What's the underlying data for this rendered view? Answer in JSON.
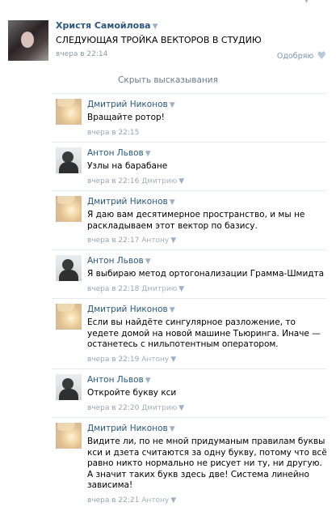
{
  "post": {
    "author": "Христя Самойлова",
    "text": "СЛЕДУЮЩАЯ ТРОЙКА ВЕКТОРОВ В СТУДИЮ",
    "date": "вчера в 22:14",
    "like_label": "Одобряю"
  },
  "icons": {
    "dropdown": "▼",
    "heart": "♥"
  },
  "hide_label": "Скрыть высказывания",
  "comments": [
    {
      "author": "Дмитрий Никонов",
      "avatar": "blond-avatar",
      "text": "Вращайте ротор!",
      "time": "вчера в 22:15",
      "reply_to": ""
    },
    {
      "author": "Антон Львов",
      "avatar": "dark-avatar",
      "text": "Узлы на барабане",
      "time": "вчера в 22:16",
      "reply_to": "Дмитрию"
    },
    {
      "author": "Дмитрий Никонов",
      "avatar": "blond-avatar",
      "text": "Я даю вам десятимерное пространство, и мы не раскладываем этот вектор по базису.",
      "time": "вчера в 22:17",
      "reply_to": "Антону"
    },
    {
      "author": "Антон Львов",
      "avatar": "dark-avatar",
      "text": "Я выбираю метод ортогонализации Грамма-Шмидта",
      "time": "вчера в 22:18",
      "reply_to": "Дмитрию"
    },
    {
      "author": "Дмитрий Никонов",
      "avatar": "blond-avatar",
      "text": "Если вы найдёте сингулярное разложение, то уедете домой на новой машине Тьюринга. Иначе — останетесь с нильпотентным оператором.",
      "time": "вчера в 22:19",
      "reply_to": "Антону"
    },
    {
      "author": "Антон Львов",
      "avatar": "dark-avatar",
      "text": "Откройте букву кси",
      "time": "вчера в 22:20",
      "reply_to": "Дмитрию"
    },
    {
      "author": "Дмитрий Никонов",
      "avatar": "blond-avatar",
      "text": "Видите ли, по не мной придуманым правилам буквы кси и дзета считаются за одну букву, потому что всё равно никто нормально не рисует ни ту, ни другую.\nА значит таких букв здесь две! Система линейно зависима!",
      "time": "вчера в 22:21",
      "reply_to": "Антону"
    }
  ]
}
